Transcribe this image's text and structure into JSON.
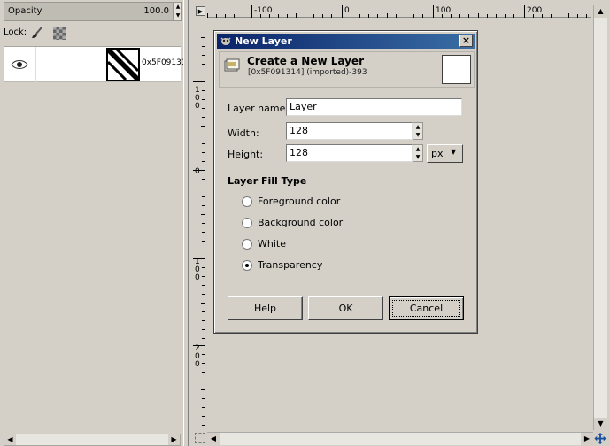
{
  "layers_panel": {
    "opacity_label": "Opacity",
    "opacity_value": "100.0",
    "lock_label": "Lock:",
    "layer_name": "0x5F09131"
  },
  "rulers": {
    "h_labels": [
      "-100",
      "0",
      "100",
      "200"
    ],
    "v_labels": [
      "1\n0\n0",
      "0",
      "1\n0\n0",
      "2\n0\n0"
    ]
  },
  "dialog": {
    "window_title": "New Layer",
    "header_title": "Create a New Layer",
    "header_subtitle": "[0x5F091314] (imported)-393",
    "layer_name_label": "Layer name:",
    "layer_name_value": "Layer",
    "width_label": "Width:",
    "width_value": "128",
    "height_label": "Height:",
    "height_value": "128",
    "unit_value": "px",
    "fill_heading": "Layer Fill Type",
    "fill_options": [
      {
        "label": "Foreground color",
        "checked": false
      },
      {
        "label": "Background color",
        "checked": false
      },
      {
        "label": "White",
        "checked": false
      },
      {
        "label": "Transparency",
        "checked": true
      }
    ],
    "help_label": "Help",
    "ok_label": "OK",
    "cancel_label": "Cancel"
  },
  "colors": {
    "titlebar_start": "#0a246a",
    "titlebar_end": "#3a6ea5",
    "panel_bg": "#d4d0c8"
  },
  "icons": [
    "eye-icon",
    "brush-icon",
    "checker-icon",
    "gimp-icon",
    "close-icon",
    "navigate-icon"
  ]
}
